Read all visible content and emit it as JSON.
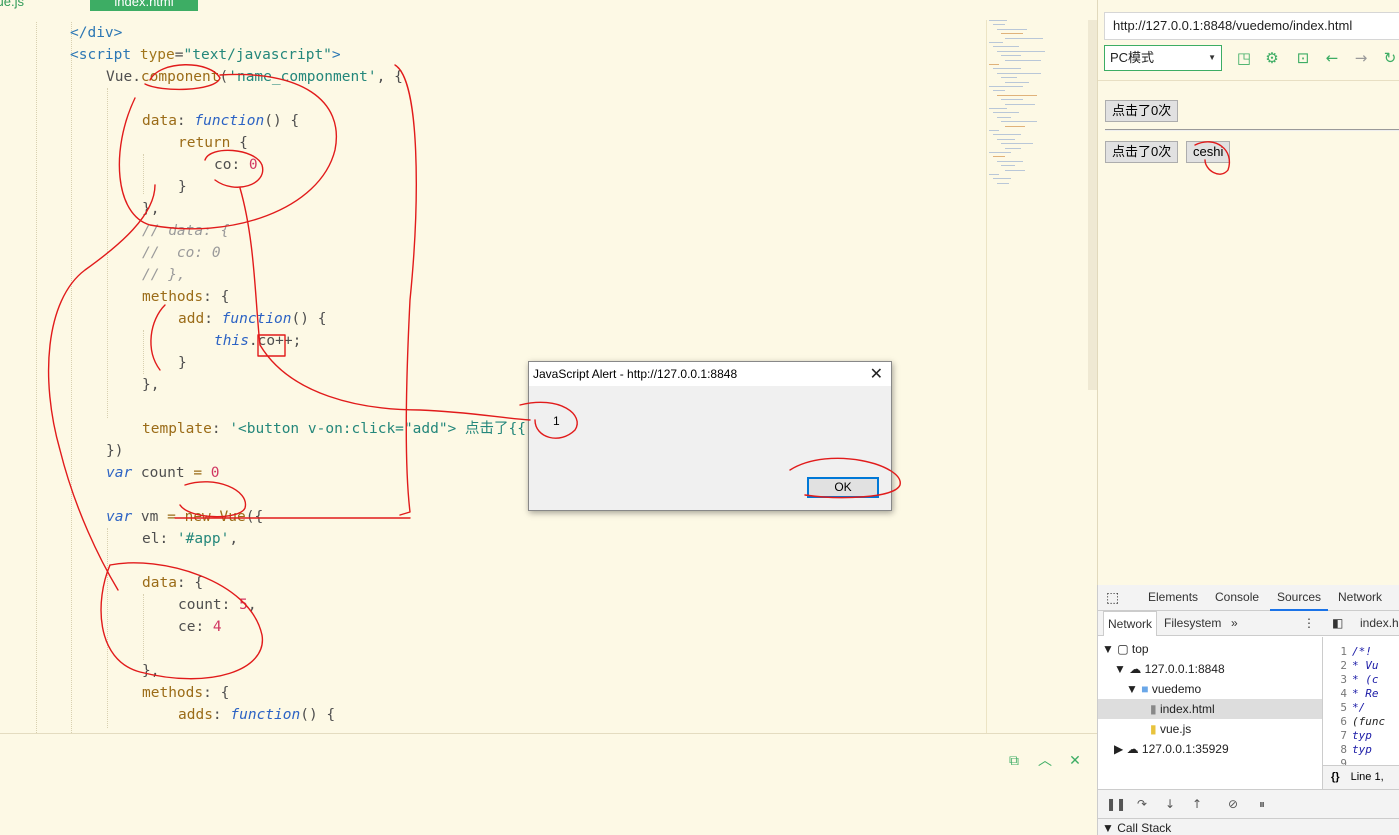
{
  "editor": {
    "tabs": [
      {
        "label": "vue.js",
        "active": false
      },
      {
        "label": "index.html",
        "active": true
      }
    ],
    "lines": [
      [
        [
          "tg",
          "</div>"
        ]
      ],
      [
        [
          "tg",
          "<script "
        ],
        [
          "at",
          "type"
        ],
        [
          "pu",
          "="
        ],
        [
          "st",
          "\"text/javascript\""
        ],
        [
          "tg",
          ">"
        ]
      ],
      [
        [
          "pu",
          "Vue."
        ],
        [
          "kn",
          "component"
        ],
        [
          "pu",
          "("
        ],
        [
          "st",
          "'name_componment'"
        ],
        [
          "pu",
          ", {"
        ]
      ],
      [],
      [
        [
          "kn",
          "data"
        ],
        [
          "pu",
          ": "
        ],
        [
          "kw",
          "function"
        ],
        [
          "pu",
          "() {"
        ]
      ],
      [
        [
          "kn",
          "return"
        ],
        [
          "pu",
          " {"
        ]
      ],
      [
        [
          "pu",
          "co: "
        ],
        [
          "nm",
          "0"
        ]
      ],
      [
        [
          "pu",
          "}"
        ]
      ],
      [
        [
          "pu",
          "},"
        ]
      ],
      [
        [
          "cm",
          "// data: {"
        ]
      ],
      [
        [
          "cm",
          "//  co: 0"
        ]
      ],
      [
        [
          "cm",
          "// },"
        ]
      ],
      [
        [
          "kn",
          "methods"
        ],
        [
          "pu",
          ": {"
        ]
      ],
      [
        [
          "kn",
          "add"
        ],
        [
          "pu",
          ": "
        ],
        [
          "kw",
          "function"
        ],
        [
          "pu",
          "() {"
        ]
      ],
      [
        [
          "kw",
          "this"
        ],
        [
          "pu",
          ".co++;"
        ]
      ],
      [
        [
          "pu",
          "}"
        ]
      ],
      [
        [
          "pu",
          "},"
        ]
      ],
      [],
      [
        [
          "kn",
          "template"
        ],
        [
          "pu",
          ": "
        ],
        [
          "st",
          "'<button v-on:click=\"add\"> 点击了{{"
        ]
      ],
      [
        [
          "pu",
          "})"
        ]
      ],
      [
        [
          "kw",
          "var"
        ],
        [
          "pu",
          " count "
        ],
        [
          "kn",
          "="
        ],
        [
          "pu",
          " "
        ],
        [
          "nm",
          "0"
        ]
      ],
      [],
      [
        [
          "kw",
          "var"
        ],
        [
          "pu",
          " vm "
        ],
        [
          "kn",
          "="
        ],
        [
          "pu",
          " "
        ],
        [
          "kn",
          "new"
        ],
        [
          "pu",
          " "
        ],
        [
          "kn",
          "Vue"
        ],
        [
          "pu",
          "({"
        ]
      ],
      [
        [
          "pu",
          "el: "
        ],
        [
          "st",
          "'#app'"
        ],
        [
          "pu",
          ","
        ]
      ],
      [],
      [
        [
          "kn",
          "data"
        ],
        [
          "pu",
          ": {"
        ]
      ],
      [
        [
          "pu",
          "count: "
        ],
        [
          "nm",
          "5"
        ],
        [
          "pu",
          ","
        ]
      ],
      [
        [
          "pu",
          "ce: "
        ],
        [
          "nm",
          "4"
        ]
      ],
      [],
      [
        [
          "pu",
          "},"
        ]
      ],
      [
        [
          "kn",
          "methods"
        ],
        [
          "pu",
          ": {"
        ]
      ],
      [
        [
          "kn",
          "adds"
        ],
        [
          "pu",
          ": "
        ],
        [
          "kw",
          "function"
        ],
        [
          "pu",
          "() {"
        ]
      ]
    ]
  },
  "bottom_panel": {
    "icons": [
      "open-in-new-icon",
      "chevron-up-icon",
      "clear-icon"
    ]
  },
  "browser": {
    "url": "http://127.0.0.1:8848/vuedemo/index.html",
    "mode": "PC模式",
    "toolbar_icons": [
      "open-external-icon",
      "settings-icon",
      "terminal-icon",
      "back-arrow-icon",
      "forward-arrow-icon",
      "refresh-icon"
    ],
    "buttons": {
      "counter_top": "点击了0次",
      "counter_bottom": "点击了0次",
      "ceshi": "ceshi"
    }
  },
  "devtools": {
    "tabs": [
      "Elements",
      "Console",
      "Sources",
      "Network"
    ],
    "selected_tab": "Sources",
    "nav_tabs": [
      "Network",
      "Filesystem"
    ],
    "open_file": "index.h",
    "tree": {
      "top": "top",
      "origin": "127.0.0.1:8848",
      "folder": "vuedemo",
      "file_selected": "index.html",
      "file_other": "vue.js",
      "origin2": "127.0.0.1:35929"
    },
    "line_numbers": [
      "1",
      "2",
      "3",
      "4",
      "5",
      "6",
      "7",
      "8",
      "9"
    ],
    "code_snippets": [
      "/*!",
      " * Vu",
      " * (c",
      " * Re",
      " */",
      "(func",
      "  typ",
      "  typ",
      ""
    ],
    "position": "Line 1,",
    "call_stack": "Call Stack"
  },
  "alert": {
    "title": "JavaScript Alert - http://127.0.0.1:8848",
    "message": "1",
    "ok": "OK"
  },
  "colors": {
    "accent_green": "#3dad64",
    "editor_bg": "#fdf9e5",
    "annotation_red": "#e11b1b"
  }
}
